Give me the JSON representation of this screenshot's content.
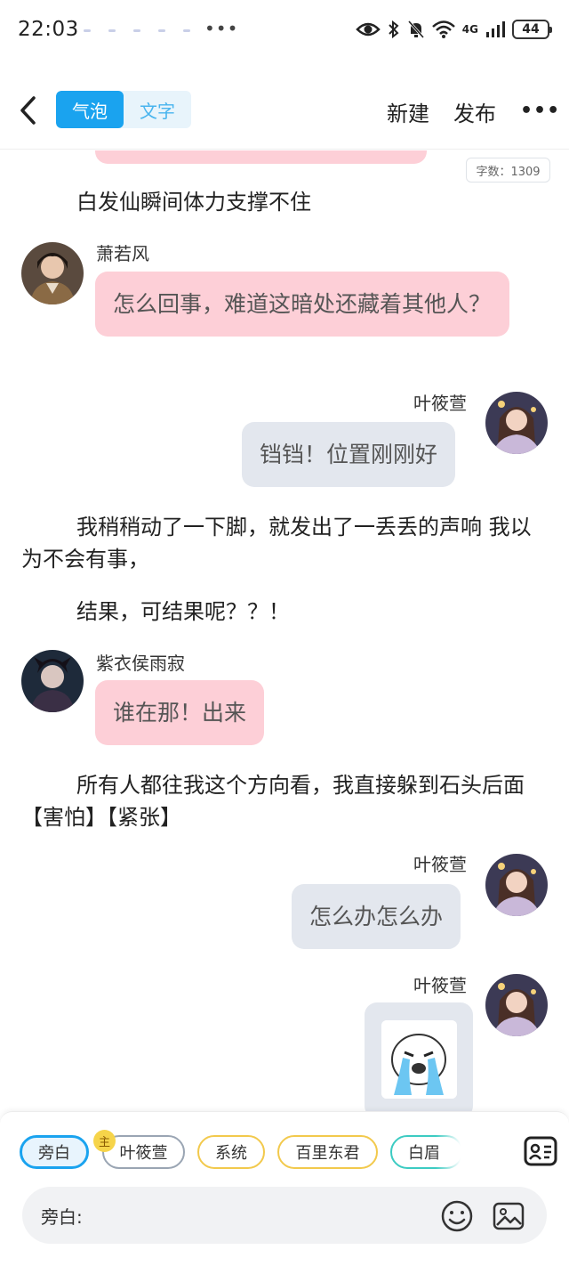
{
  "status_bar": {
    "time": "22:03",
    "overflow_dots": "•••",
    "network": "4G",
    "battery": "44"
  },
  "header": {
    "mode_tabs": [
      "气泡",
      "文字"
    ],
    "new_label": "新建",
    "publish_label": "发布",
    "more_label": "•••"
  },
  "chat": {
    "word_count": "字数：1309",
    "messages": [
      {
        "type": "narration",
        "text": "白发仙瞬间体力支撑不住"
      },
      {
        "type": "left",
        "name": "萧若风",
        "text": "怎么回事，难道这暗处还藏着其他人？"
      },
      {
        "type": "right",
        "name": "叶筱萱",
        "text": "铛铛！位置刚刚好"
      },
      {
        "type": "narration",
        "text": "我稍稍动了一下脚，就发出了一丢丢的声响 我以为不会有事，"
      },
      {
        "type": "narration",
        "text": "结果，可结果呢？？！"
      },
      {
        "type": "left",
        "name": "紫衣侯雨寂",
        "text": "谁在那！出来"
      },
      {
        "type": "narration",
        "text": "所有人都往我这个方向看，我直接躲到石头后面【害怕】【紧张】"
      },
      {
        "type": "right",
        "name": "叶筱萱",
        "text": "怎么办怎么办"
      },
      {
        "type": "right-sticker",
        "name": "叶筱萱"
      }
    ]
  },
  "bottom": {
    "roles": [
      "旁白",
      "叶筱萱",
      "系统",
      "百里东君",
      "白眉"
    ],
    "main_tag": "主",
    "input_label": "旁白:",
    "input_placeholder": ""
  },
  "colors": {
    "accent": "#1aa3ef",
    "left_bubble": "#fdcfd7",
    "right_bubble": "#e3e7ee"
  }
}
